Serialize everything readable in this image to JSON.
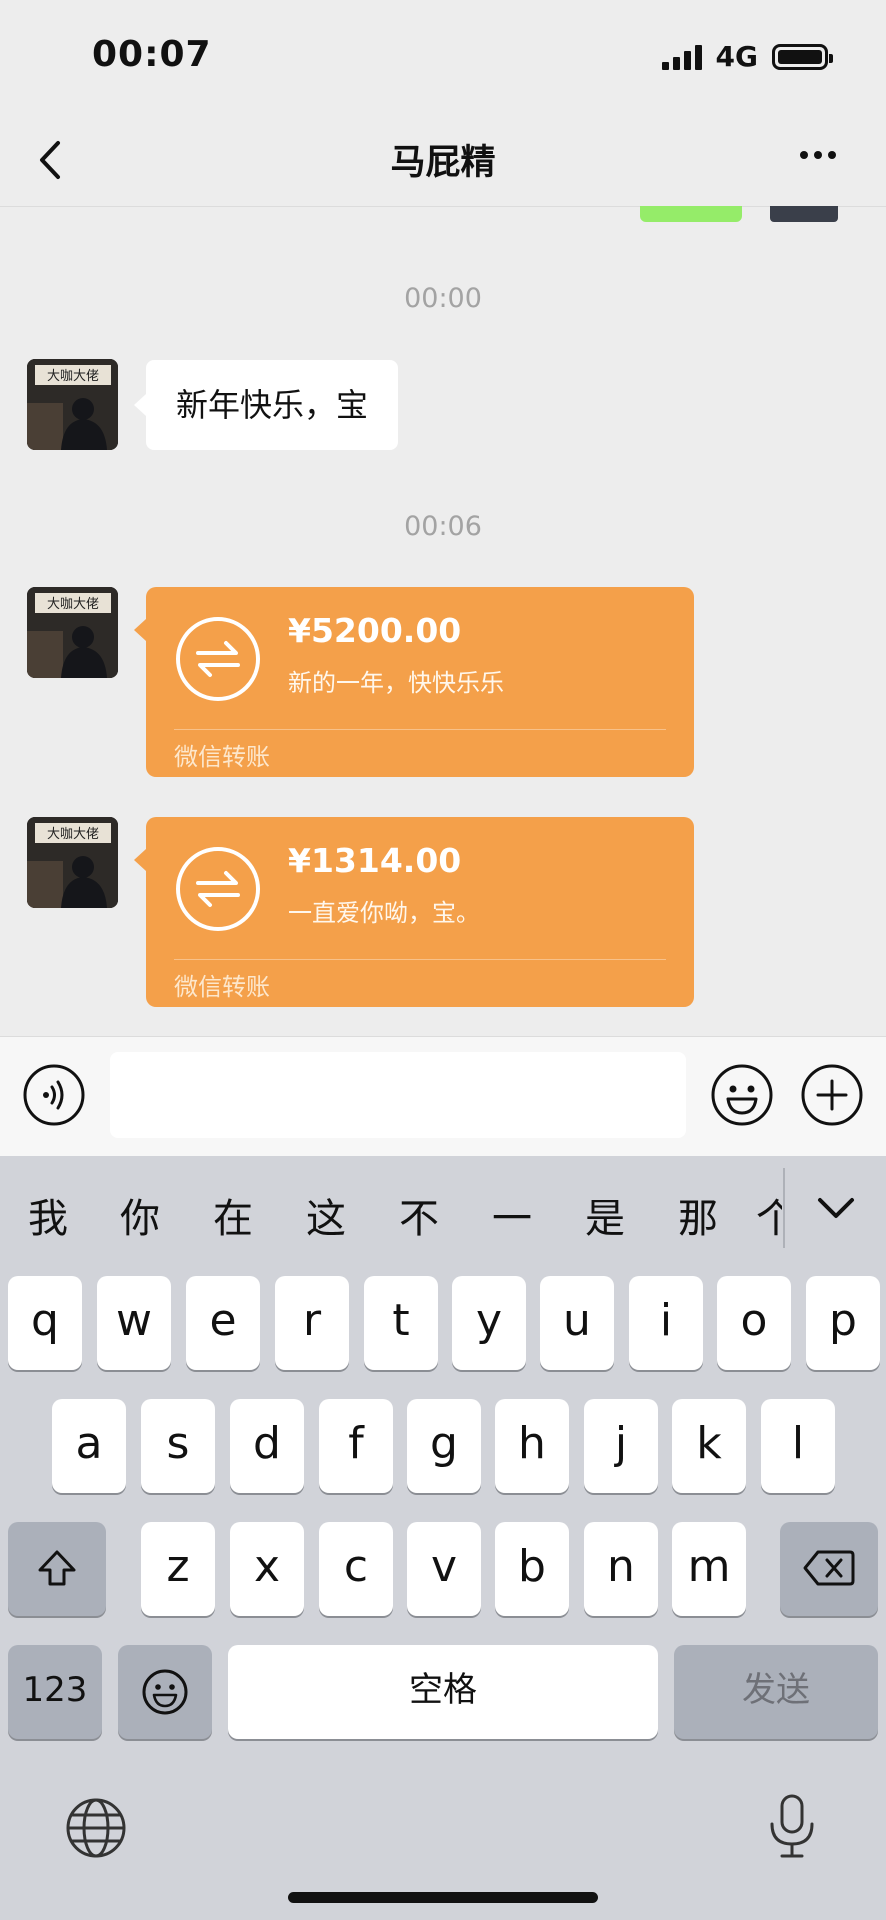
{
  "status": {
    "time": "00:07",
    "network": "4G"
  },
  "chat": {
    "title": "马屁精"
  },
  "messages": {
    "ts1": "00:00",
    "text1": "新年快乐，宝",
    "ts2": "00:06",
    "transfer1": {
      "amount": "¥5200.00",
      "note": "新的一年，快快乐乐",
      "label": "微信转账"
    },
    "transfer2": {
      "amount": "¥1314.00",
      "note": "一直爱你呦，宝。",
      "label": "微信转账"
    }
  },
  "input": {
    "placeholder": ""
  },
  "candidates": [
    "我",
    "你",
    "在",
    "这",
    "不",
    "一",
    "是",
    "那",
    "个"
  ],
  "keyboard": {
    "row1": [
      "q",
      "w",
      "e",
      "r",
      "t",
      "y",
      "u",
      "i",
      "o",
      "p"
    ],
    "row2": [
      "a",
      "s",
      "d",
      "f",
      "g",
      "h",
      "j",
      "k",
      "l"
    ],
    "row3": [
      "z",
      "x",
      "c",
      "v",
      "b",
      "n",
      "m"
    ],
    "numbers": "123",
    "space": "空格",
    "send": "发送"
  },
  "icons": {
    "back": "chevron-left-icon",
    "more": "more-icon",
    "voice": "voice-icon",
    "emoji": "emoji-icon",
    "add": "plus-icon",
    "shift": "shift-icon",
    "delete": "backspace-icon",
    "globe": "globe-icon",
    "mic": "mic-icon",
    "transfer": "transfer-icon",
    "collapse": "chevron-down-icon"
  },
  "colors": {
    "transfer": "#f4a04a",
    "bubble": "#ffffff",
    "background": "#ededed",
    "keyboard": "#d1d3d9"
  }
}
